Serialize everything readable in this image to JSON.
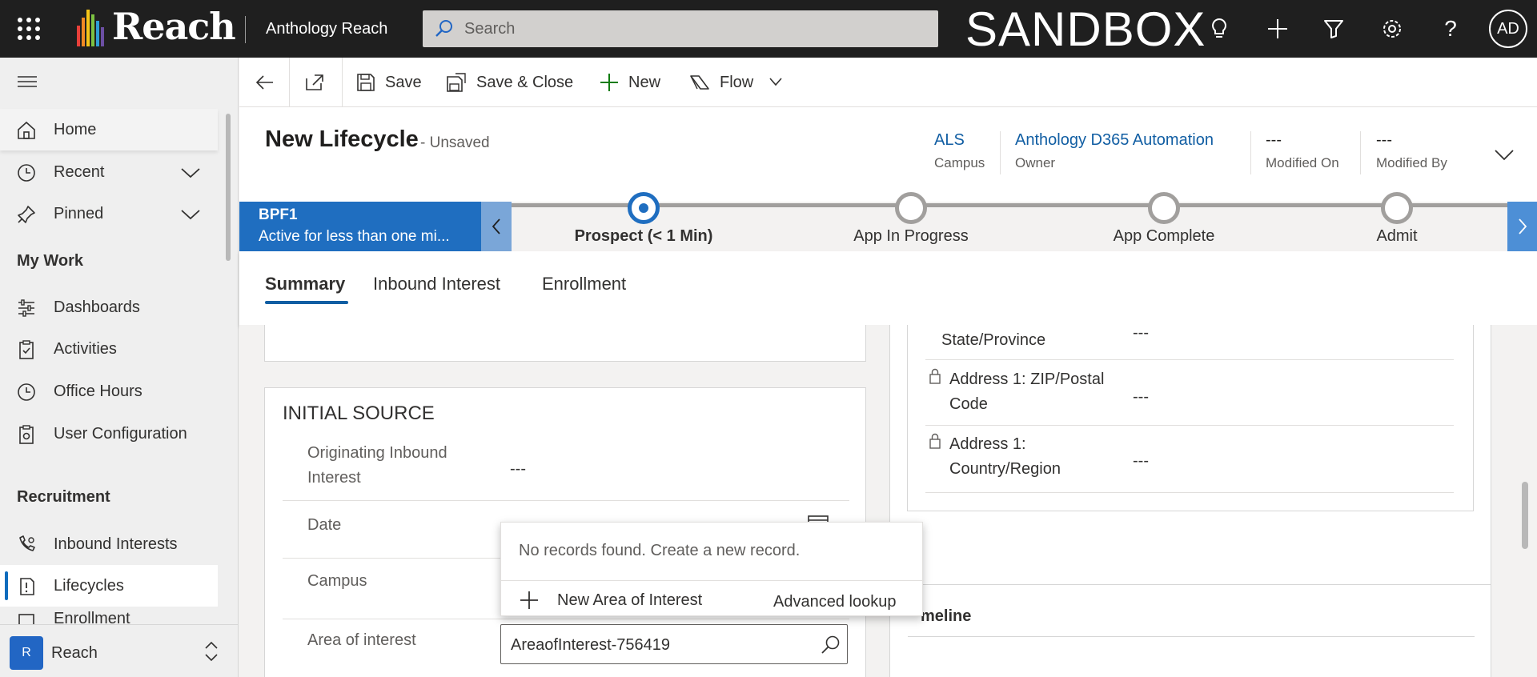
{
  "topbar": {
    "brand": "Reach",
    "app_name": "Anthology Reach",
    "search_placeholder": "Search",
    "environment": "SANDBOX",
    "avatar_initials": "AD",
    "brand_colors": [
      "#e8403a",
      "#f08a24",
      "#f5c518",
      "#7cc242",
      "#2e9ed6",
      "#6c4fa3"
    ]
  },
  "sidebar": {
    "items": [
      {
        "label": "Home",
        "icon": "home-icon"
      },
      {
        "label": "Recent",
        "icon": "clock-icon",
        "expandable": true
      },
      {
        "label": "Pinned",
        "icon": "pin-icon",
        "expandable": true
      }
    ],
    "my_work": {
      "title": "My Work",
      "items": [
        {
          "label": "Dashboards",
          "icon": "dashboard-icon"
        },
        {
          "label": "Activities",
          "icon": "clipboard-icon"
        },
        {
          "label": "Office Hours",
          "icon": "clock-icon"
        },
        {
          "label": "User Configuration",
          "icon": "clipboard-settings-icon"
        }
      ]
    },
    "recruitment": {
      "title": "Recruitment",
      "items": [
        {
          "label": "Inbound Interests",
          "icon": "phone-settings-icon"
        },
        {
          "label": "Lifecycles",
          "icon": "lifecycle-icon",
          "selected": true
        },
        {
          "label": "Enrollment",
          "icon": "enrollment-icon"
        }
      ]
    },
    "area": {
      "badge": "R",
      "name": "Reach"
    }
  },
  "commandbar": {
    "save": "Save",
    "save_close": "Save & Close",
    "new": "New",
    "flow": "Flow"
  },
  "header": {
    "title": "New Lifecycle",
    "status": "- Unsaved",
    "fields": [
      {
        "value": "ALS",
        "label": "Campus",
        "link": true
      },
      {
        "value": "Anthology D365 Automation",
        "label": "Owner",
        "link": true
      },
      {
        "value": "---",
        "label": "Modified On"
      },
      {
        "value": "---",
        "label": "Modified By"
      }
    ]
  },
  "bpf": {
    "name": "BPF1",
    "active_for": "Active for less than one mi...",
    "stages": [
      {
        "label": "Prospect  (< 1 Min)",
        "active": true
      },
      {
        "label": "App In Progress"
      },
      {
        "label": "App Complete"
      },
      {
        "label": "Admit"
      }
    ]
  },
  "tabs": [
    {
      "label": "Summary",
      "active": true
    },
    {
      "label": "Inbound Interest"
    },
    {
      "label": "Enrollment"
    }
  ],
  "initial_source": {
    "title": "INITIAL SOURCE",
    "fields": [
      {
        "label": "Originating Inbound Interest",
        "value": "---"
      },
      {
        "label": "Date",
        "value": ""
      },
      {
        "label": "Campus",
        "value": ""
      },
      {
        "label": "Area of interest",
        "value": "AreaofInterest-756419"
      }
    ]
  },
  "address": {
    "fields": [
      {
        "label": "Address 1: State/Province",
        "value": "---"
      },
      {
        "label": "Address 1: ZIP/Postal Code",
        "value": "---"
      },
      {
        "label": "Address 1: Country/Region",
        "value": "---"
      }
    ]
  },
  "timeline": {
    "title": "Timeline",
    "visible_title": "meline"
  },
  "lookup_dropdown": {
    "message": "No records found. Create a new record.",
    "new_label": "New Area of Interest",
    "advanced": "Advanced lookup"
  }
}
